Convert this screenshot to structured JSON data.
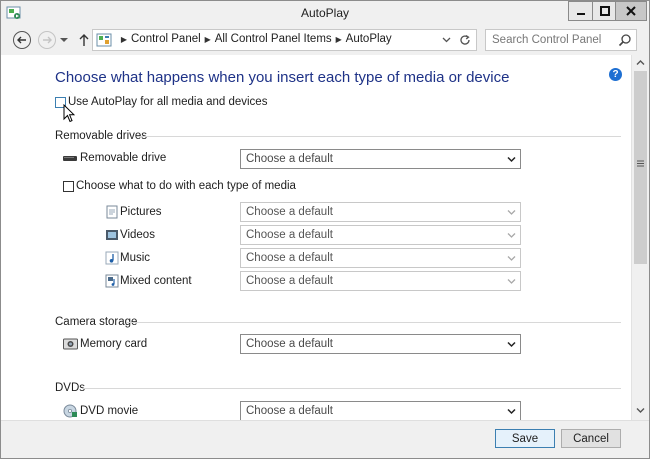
{
  "window": {
    "title": "AutoPlay"
  },
  "address": {
    "crumbs": [
      "Control Panel",
      "All Control Panel Items",
      "AutoPlay"
    ]
  },
  "search": {
    "placeholder": "Search Control Panel"
  },
  "main": {
    "heading": "Choose what happens when you insert each type of media or device",
    "use_autoplay_label": "Use AutoPlay for all media and devices",
    "use_autoplay_checked": false,
    "sections": {
      "removable": {
        "title": "Removable drives",
        "drive_label": "Removable drive",
        "drive_value": "Choose a default",
        "choose_each_label": "Choose what to do with each type of media",
        "media": [
          {
            "label": "Pictures",
            "value": "Choose a default",
            "icon": "pictures-icon"
          },
          {
            "label": "Videos",
            "value": "Choose a default",
            "icon": "videos-icon"
          },
          {
            "label": "Music",
            "value": "Choose a default",
            "icon": "music-icon"
          },
          {
            "label": "Mixed content",
            "value": "Choose a default",
            "icon": "mixed-content-icon"
          }
        ]
      },
      "camera": {
        "title": "Camera storage",
        "memory_label": "Memory card",
        "memory_value": "Choose a default"
      },
      "dvds": {
        "title": "DVDs",
        "dvd_label": "DVD movie",
        "dvd_value": "Choose a default"
      }
    }
  },
  "footer": {
    "save": "Save",
    "cancel": "Cancel"
  },
  "colors": {
    "heading": "#1e3287",
    "accent": "#3c7fb1",
    "help": "#1e6fd2"
  }
}
